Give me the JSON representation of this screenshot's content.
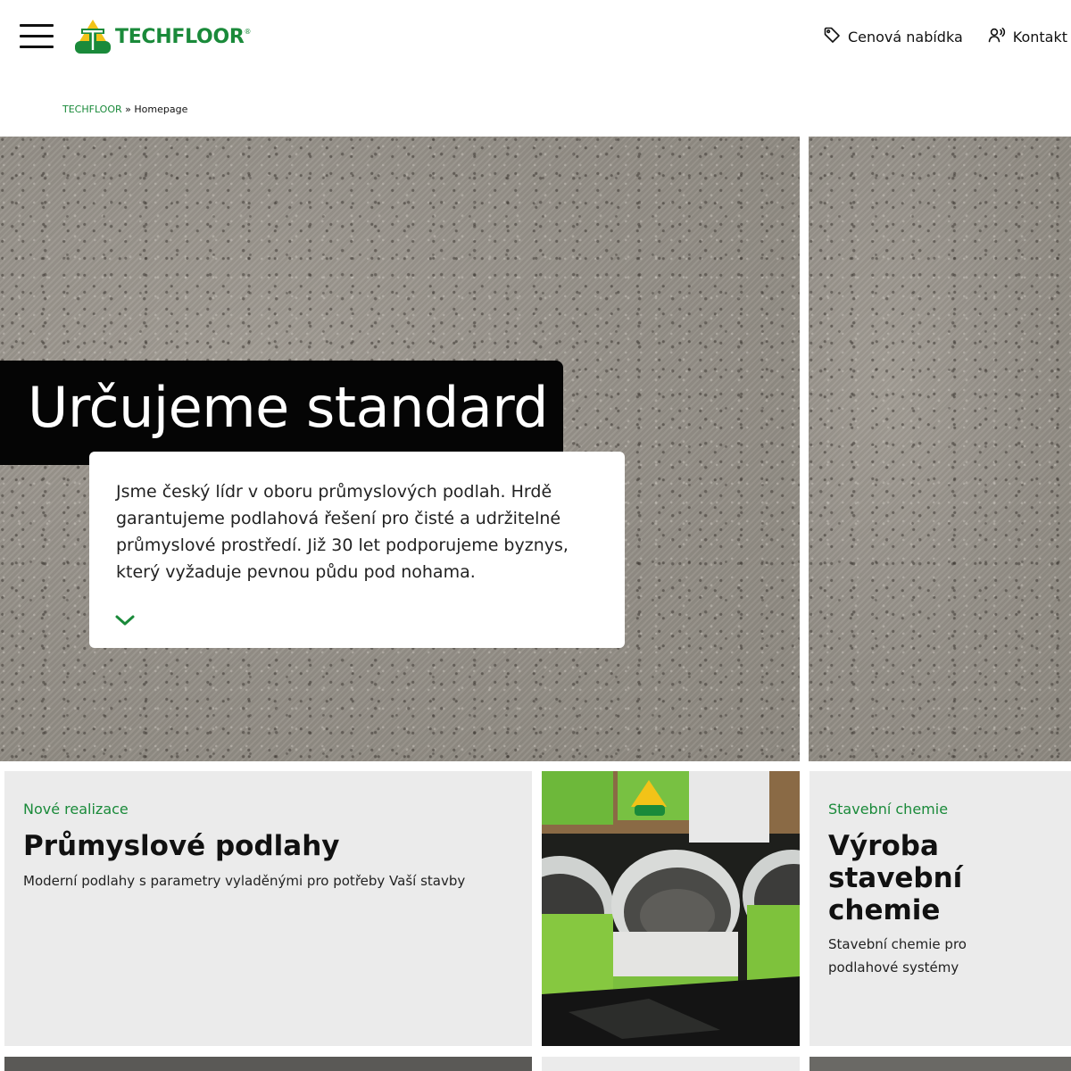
{
  "header": {
    "logo_text": "TECHFLOOR",
    "logo_reg": "®",
    "nav": [
      {
        "label": "Cenová nabídka",
        "icon": "tag-icon"
      },
      {
        "label": "Kontakt",
        "icon": "contact-person-icon"
      }
    ]
  },
  "breadcrumb": {
    "root": "TECHFLOOR",
    "separator": "»",
    "current": "Homepage"
  },
  "hero": {
    "title": "Určujeme standard",
    "text": "Jsme český lídr v oboru průmyslových podlah. Hrdě garantujeme podlahová řešení pro čisté a udržitelné průmyslové prostředí. Již 30 let podporujeme byznys, který vyžaduje pevnou půdu pod nohama.",
    "scroll_icon": "chevron-down-icon"
  },
  "cards": [
    {
      "kicker": "Nové realizace",
      "title": "Průmyslové podlahy",
      "desc": "Moderní podlahy s parametry vyladěnými pro potřeby Vaší stavby"
    },
    {
      "image": "techfloor-paint-buckets-photo"
    },
    {
      "kicker": "Stavební chemie",
      "title": "Výroba stavební chemie",
      "desc": "Stavební chemie pro podlahové systémy"
    }
  ],
  "colors": {
    "brand_green": "#1a8a3a",
    "logo_yellow": "#f2c318",
    "card_grey": "#ebebeb",
    "title_box": "#050505"
  }
}
